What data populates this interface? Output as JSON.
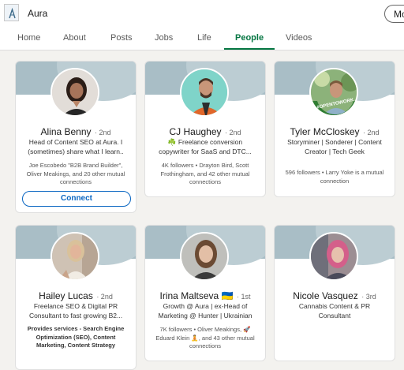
{
  "company": {
    "name": "Aura",
    "more_label": "Mo"
  },
  "tabs": [
    "Home",
    "About",
    "Posts",
    "Jobs",
    "Life",
    "People",
    "Videos"
  ],
  "active_tab": "People",
  "cards": [
    {
      "name": "Alina Benny",
      "degree": "· 2nd",
      "headline_lines": [
        "Head of Content SEO at Aura. I",
        "(sometimes) share what I learn.."
      ],
      "mutual_lines": [
        "Joe Escobedo \"B2B Brand Builder\",",
        "Oliver Meakings, and 20 other mutual",
        "connections"
      ],
      "button": "Connect"
    },
    {
      "name": "CJ Haughey",
      "degree": "· 2nd",
      "headline_lines": [
        "☘️ Freelance conversion",
        "copywriter for SaaS and DTC..."
      ],
      "mutual_lines": [
        "4K followers • Drayton Bird, Scott",
        "Frothingham, and 42 other mutual",
        "connections"
      ]
    },
    {
      "name": "Tyler McCloskey",
      "degree": "· 2nd",
      "frame_text": "#OPENTOWORK",
      "headline_lines": [
        "Storyminer | Sonderer | Content",
        "Creator | Tech Geek"
      ],
      "mutual_lines": [
        "596 followers • Larry Yoke is a mutual",
        "connection"
      ]
    },
    {
      "name": "Hailey Lucas",
      "degree": "· 2nd",
      "headline_lines": [
        "Freelance SEO & Digital PR",
        "Consultant to fast growing B2..."
      ],
      "services_lines": [
        "Provides services - Search Engine",
        "Optimization (SEO), Content",
        "Marketing, Content Strategy"
      ]
    },
    {
      "name": "Irina Maltseva 🇺🇦",
      "degree": "· 1st",
      "headline_lines": [
        "Growth @ Aura | ex-Head of",
        "Marketing @ Hunter | Ukrainian"
      ],
      "mutual_lines": [
        "7K followers • Oliver Meakings, 🚀",
        "Eduard Klein 🧘, and 43 other mutual",
        "connections"
      ]
    },
    {
      "name": "Nicole Vasquez",
      "degree": "· 3rd",
      "headline_lines": [
        "Cannabis Content & PR",
        "Consultant"
      ]
    }
  ],
  "colors": {
    "accent_green": "#057642",
    "link_blue": "#0a66c2",
    "banner": "#a9bec6",
    "opentowork_green": "#2f7d32"
  },
  "icons": [
    "aura-logo-icon"
  ]
}
